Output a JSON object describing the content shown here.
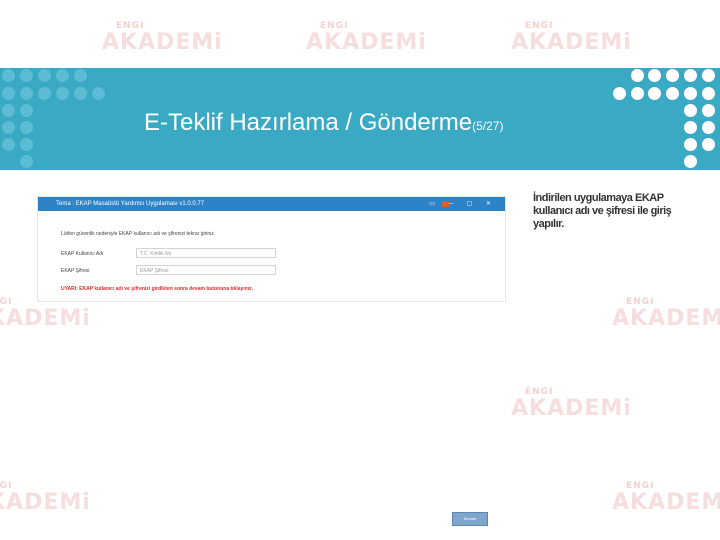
{
  "slide": {
    "title": "E-Teklif Hazırlama /  Gönderme",
    "page_indicator": "(5/27)"
  },
  "watermark": {
    "tag": "ENGI",
    "brand": "AKADEMi"
  },
  "app_window": {
    "title": "Tema :  EKAP Masaüstü Yardımcı Uygulaması v1.0.0.77",
    "controls": "▭ ─ ▢ ✕",
    "message": "Lütfen güvenlik nedeniyle EKAP kullanıcı adı ve şifrenizi tekrar giriniz.",
    "username_label": "EKAP Kullanıcı Adı",
    "username_placeholder": "T.C. Kimlik No",
    "password_label": "EKAP Şifresi",
    "password_placeholder": "EKAP Şifresi",
    "warning": "UYARI: EKAP kullanıcı adı ve şifrenizi girdikten sonra devam butonuna tıklayınız.",
    "continue_button": "Devam"
  },
  "side_note": "İndirilen uygulamaya EKAP kullanıcı adı ve şifresi ile giriş yapılır.",
  "colors": {
    "band": "#3aa9c4",
    "app_bar": "#2e83c7",
    "warning": "#d9302c"
  }
}
